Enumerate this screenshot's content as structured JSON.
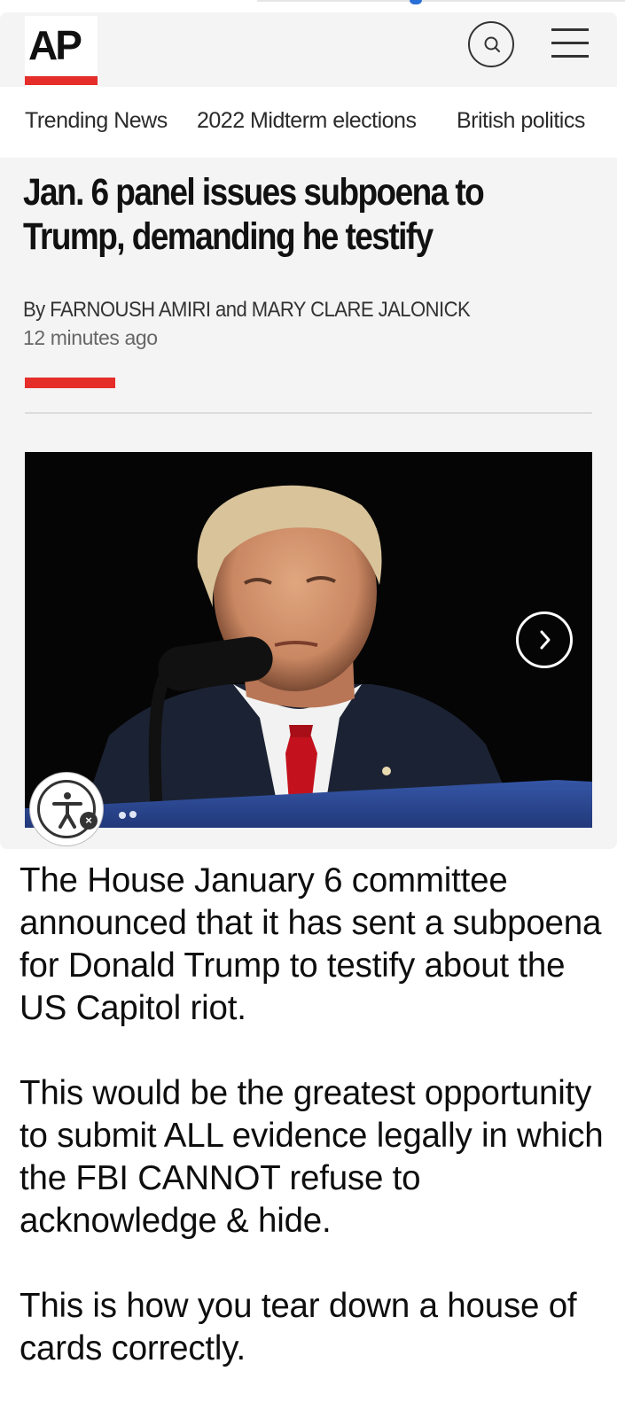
{
  "header": {
    "logo": "AP",
    "search_icon": "search-icon",
    "menu_icon": "hamburger-menu-icon"
  },
  "nav": {
    "items": [
      "Trending News",
      "2022 Midterm elections",
      "British politics"
    ]
  },
  "article": {
    "headline": "Jan. 6 panel issues subpoena to Trump, demanding he testify",
    "byline": "By FARNOUSH AMIRI and MARY CLARE JALONICK",
    "timestamp": "12 minutes ago",
    "photo_next_icon": "chevron-right-icon",
    "accessibility_icon": "accessibility-icon"
  },
  "post": {
    "paragraphs": [
      "The House January 6 committee announced that it has sent a subpoena for Donald Trump to testify about the US Capitol riot.",
      "This would be the greatest opportunity to submit ALL evidence legally in which the FBI CANNOT refuse to acknowledge & hide.",
      "This is how you tear down a house of cards correctly."
    ]
  },
  "colors": {
    "ap_red": "#e52d2a",
    "card_bg": "#f4f4f4",
    "photo_bg": "#050505"
  }
}
